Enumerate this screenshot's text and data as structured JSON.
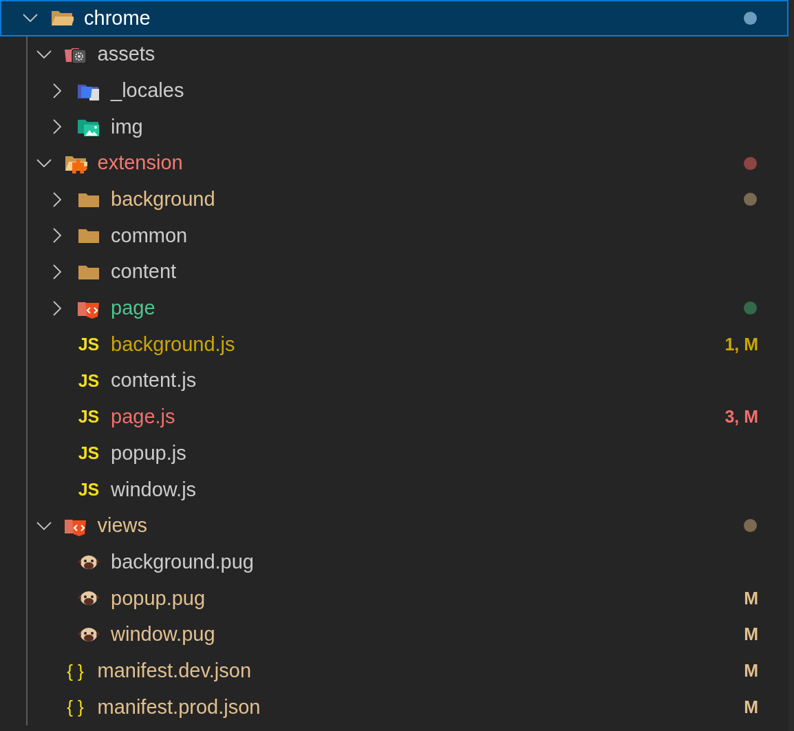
{
  "tree": [
    {
      "name": "chrome",
      "kind": "folder-open",
      "expanded": true,
      "selected": true,
      "color": "#ffffff",
      "dot": {
        "color": "#6d9dbd"
      },
      "children": [
        {
          "name": "assets",
          "kind": "folder-config",
          "expanded": true,
          "selected": false,
          "color": "#cccccc",
          "children": [
            {
              "name": "_locales",
              "kind": "folder-i18n",
              "expanded": false,
              "selected": false,
              "color": "#cccccc"
            },
            {
              "name": "img",
              "kind": "folder-images",
              "expanded": false,
              "selected": false,
              "color": "#cccccc"
            }
          ]
        },
        {
          "name": "extension",
          "kind": "folder-plugin",
          "expanded": true,
          "selected": false,
          "color": "#f47a6e",
          "dot": {
            "color": "#8c4542"
          },
          "children": [
            {
              "name": "background",
              "kind": "folder",
              "expanded": false,
              "selected": false,
              "color": "#e2c08d",
              "dot": {
                "color": "#7b6a52"
              }
            },
            {
              "name": "common",
              "kind": "folder",
              "expanded": false,
              "selected": false,
              "color": "#cccccc"
            },
            {
              "name": "content",
              "kind": "folder",
              "expanded": false,
              "selected": false,
              "color": "#cccccc"
            },
            {
              "name": "page",
              "kind": "folder-html",
              "expanded": false,
              "selected": false,
              "color": "#4ec58f",
              "dot": {
                "color": "#326a4b"
              }
            },
            {
              "name": "background.js",
              "kind": "js",
              "icon_text": "JS",
              "selected": false,
              "color": "#cca700",
              "badge": "1, M"
            },
            {
              "name": "content.js",
              "kind": "js",
              "icon_text": "JS",
              "selected": false,
              "color": "#cccccc"
            },
            {
              "name": "page.js",
              "kind": "js",
              "icon_text": "JS",
              "selected": false,
              "color": "#f0706a",
              "badge": "3, M"
            },
            {
              "name": "popup.js",
              "kind": "js",
              "icon_text": "JS",
              "selected": false,
              "color": "#cccccc"
            },
            {
              "name": "window.js",
              "kind": "js",
              "icon_text": "JS",
              "selected": false,
              "color": "#cccccc"
            }
          ]
        },
        {
          "name": "views",
          "kind": "folder-html",
          "expanded": true,
          "selected": false,
          "color": "#e2c08d",
          "dot": {
            "color": "#7b6a52"
          },
          "children": [
            {
              "name": "background.pug",
              "kind": "pug",
              "selected": false,
              "color": "#cccccc"
            },
            {
              "name": "popup.pug",
              "kind": "pug",
              "selected": false,
              "color": "#e2c08d",
              "badge": "M"
            },
            {
              "name": "window.pug",
              "kind": "pug",
              "selected": false,
              "color": "#e2c08d",
              "badge": "M"
            }
          ]
        },
        {
          "name": "manifest.dev.json",
          "kind": "json",
          "icon_text": "{ }",
          "selected": false,
          "color": "#e2c08d",
          "badge": "M"
        },
        {
          "name": "manifest.prod.json",
          "kind": "json",
          "icon_text": "{ }",
          "selected": false,
          "color": "#e2c08d",
          "badge": "M"
        }
      ]
    }
  ]
}
